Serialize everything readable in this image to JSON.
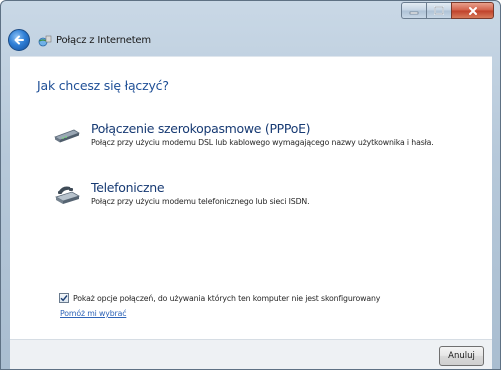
{
  "window": {
    "title": "Połącz z Internetem",
    "accent_color": "#2f7fd6",
    "close_color": "#c0402a"
  },
  "titlebar": {
    "buttons": [
      {
        "name": "minimize",
        "icon": "minimize-icon"
      },
      {
        "name": "maximize",
        "icon": "maximize-icon"
      },
      {
        "name": "close",
        "icon": "close-icon"
      }
    ]
  },
  "nav": {
    "back_icon": "back-arrow-icon",
    "wizard_icon": "network-globe-icon"
  },
  "main": {
    "heading": "Jak chcesz się łączyć?",
    "heading_color": "#1f4f96",
    "options": [
      {
        "title": "Połączenie szerokopasmowe (PPPoE)",
        "description": "Połącz przy użyciu modemu DSL lub kablowego wymagającego nazwy użytkownika i hasła.",
        "icon": "broadband-modem-icon"
      },
      {
        "title": "Telefoniczne",
        "description": "Połącz przy użyciu modemu telefonicznego lub sieci ISDN.",
        "icon": "dial-up-modem-icon"
      }
    ],
    "show_options_checkbox": {
      "label": "Pokaż opcje połączeń, do używania których ten komputer nie jest skonfigurowany",
      "checked": true
    },
    "help_link": "Pomóż mi wybrać"
  },
  "footer": {
    "cancel_label": "Anuluj"
  }
}
